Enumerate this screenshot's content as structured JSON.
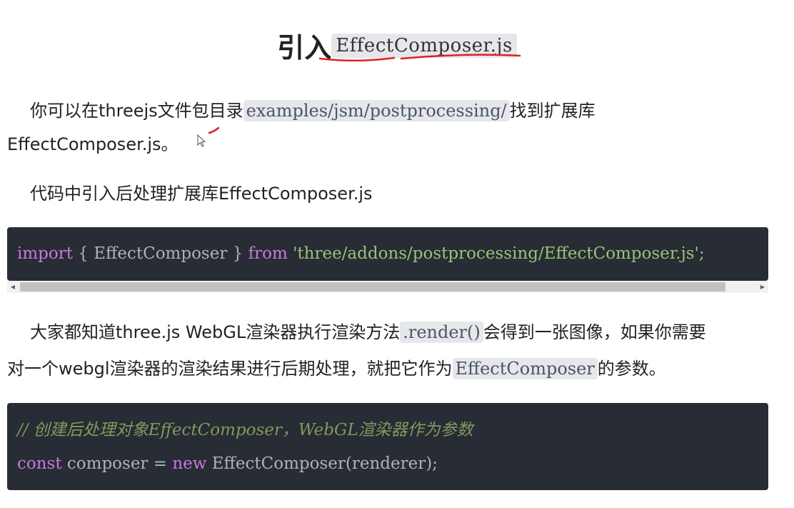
{
  "heading": {
    "prefix": "引入",
    "code": "EffectComposer.js"
  },
  "para1": {
    "before": "你可以在threejs文件包目录",
    "code": "examples/jsm/postprocessing/",
    "after": "找到扩展库",
    "line2": "EffectComposer.js。"
  },
  "para2": {
    "text": "代码中引入后处理扩展库EffectComposer.js"
  },
  "code1": {
    "kw_import": "import",
    "braces": " { EffectComposer } ",
    "kw_from": "from",
    "string": " 'three/addons/postprocessing/EffectComposer.js';"
  },
  "para3": {
    "before": "大家都知道three.js WebGL渲染器执行渲染方法",
    "code": ".render()",
    "after": "会得到一张图像，如果你需要",
    "line2_before": "对一个webgl渲染器的渲染结果进行后期处理，就把它作为",
    "line2_code": "EffectComposer",
    "line2_after": "的参数。"
  },
  "code2": {
    "comment": "// 创建后处理对象EffectComposer，WebGL渲染器作为参数",
    "kw_const": "const",
    "mid": " composer = ",
    "kw_new": "new",
    "rest": " EffectComposer(renderer);"
  },
  "colors": {
    "code_bg": "#282c34",
    "keyword": "#c678dd",
    "string": "#98c379",
    "comment": "#7f9b5e",
    "annotation_red": "#e02020"
  },
  "icons": {
    "scroll_left": "triangle-left",
    "scroll_right": "triangle-right",
    "cursor": "mouse-pointer"
  }
}
